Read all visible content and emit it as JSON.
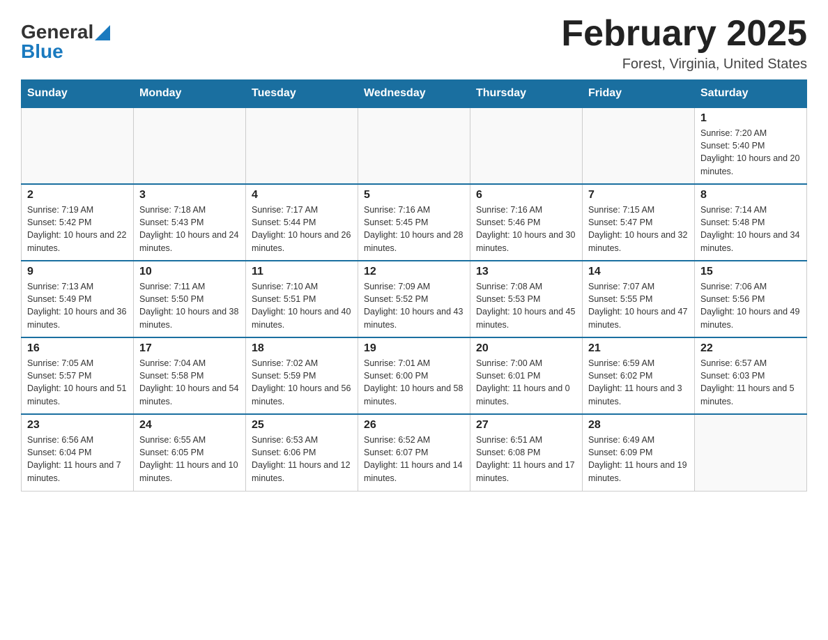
{
  "header": {
    "logo_general": "General",
    "logo_blue": "Blue",
    "month_title": "February 2025",
    "location": "Forest, Virginia, United States"
  },
  "days_of_week": [
    "Sunday",
    "Monday",
    "Tuesday",
    "Wednesday",
    "Thursday",
    "Friday",
    "Saturday"
  ],
  "weeks": [
    [
      {
        "day": "",
        "sunrise": "",
        "sunset": "",
        "daylight": ""
      },
      {
        "day": "",
        "sunrise": "",
        "sunset": "",
        "daylight": ""
      },
      {
        "day": "",
        "sunrise": "",
        "sunset": "",
        "daylight": ""
      },
      {
        "day": "",
        "sunrise": "",
        "sunset": "",
        "daylight": ""
      },
      {
        "day": "",
        "sunrise": "",
        "sunset": "",
        "daylight": ""
      },
      {
        "day": "",
        "sunrise": "",
        "sunset": "",
        "daylight": ""
      },
      {
        "day": "1",
        "sunrise": "Sunrise: 7:20 AM",
        "sunset": "Sunset: 5:40 PM",
        "daylight": "Daylight: 10 hours and 20 minutes."
      }
    ],
    [
      {
        "day": "2",
        "sunrise": "Sunrise: 7:19 AM",
        "sunset": "Sunset: 5:42 PM",
        "daylight": "Daylight: 10 hours and 22 minutes."
      },
      {
        "day": "3",
        "sunrise": "Sunrise: 7:18 AM",
        "sunset": "Sunset: 5:43 PM",
        "daylight": "Daylight: 10 hours and 24 minutes."
      },
      {
        "day": "4",
        "sunrise": "Sunrise: 7:17 AM",
        "sunset": "Sunset: 5:44 PM",
        "daylight": "Daylight: 10 hours and 26 minutes."
      },
      {
        "day": "5",
        "sunrise": "Sunrise: 7:16 AM",
        "sunset": "Sunset: 5:45 PM",
        "daylight": "Daylight: 10 hours and 28 minutes."
      },
      {
        "day": "6",
        "sunrise": "Sunrise: 7:16 AM",
        "sunset": "Sunset: 5:46 PM",
        "daylight": "Daylight: 10 hours and 30 minutes."
      },
      {
        "day": "7",
        "sunrise": "Sunrise: 7:15 AM",
        "sunset": "Sunset: 5:47 PM",
        "daylight": "Daylight: 10 hours and 32 minutes."
      },
      {
        "day": "8",
        "sunrise": "Sunrise: 7:14 AM",
        "sunset": "Sunset: 5:48 PM",
        "daylight": "Daylight: 10 hours and 34 minutes."
      }
    ],
    [
      {
        "day": "9",
        "sunrise": "Sunrise: 7:13 AM",
        "sunset": "Sunset: 5:49 PM",
        "daylight": "Daylight: 10 hours and 36 minutes."
      },
      {
        "day": "10",
        "sunrise": "Sunrise: 7:11 AM",
        "sunset": "Sunset: 5:50 PM",
        "daylight": "Daylight: 10 hours and 38 minutes."
      },
      {
        "day": "11",
        "sunrise": "Sunrise: 7:10 AM",
        "sunset": "Sunset: 5:51 PM",
        "daylight": "Daylight: 10 hours and 40 minutes."
      },
      {
        "day": "12",
        "sunrise": "Sunrise: 7:09 AM",
        "sunset": "Sunset: 5:52 PM",
        "daylight": "Daylight: 10 hours and 43 minutes."
      },
      {
        "day": "13",
        "sunrise": "Sunrise: 7:08 AM",
        "sunset": "Sunset: 5:53 PM",
        "daylight": "Daylight: 10 hours and 45 minutes."
      },
      {
        "day": "14",
        "sunrise": "Sunrise: 7:07 AM",
        "sunset": "Sunset: 5:55 PM",
        "daylight": "Daylight: 10 hours and 47 minutes."
      },
      {
        "day": "15",
        "sunrise": "Sunrise: 7:06 AM",
        "sunset": "Sunset: 5:56 PM",
        "daylight": "Daylight: 10 hours and 49 minutes."
      }
    ],
    [
      {
        "day": "16",
        "sunrise": "Sunrise: 7:05 AM",
        "sunset": "Sunset: 5:57 PM",
        "daylight": "Daylight: 10 hours and 51 minutes."
      },
      {
        "day": "17",
        "sunrise": "Sunrise: 7:04 AM",
        "sunset": "Sunset: 5:58 PM",
        "daylight": "Daylight: 10 hours and 54 minutes."
      },
      {
        "day": "18",
        "sunrise": "Sunrise: 7:02 AM",
        "sunset": "Sunset: 5:59 PM",
        "daylight": "Daylight: 10 hours and 56 minutes."
      },
      {
        "day": "19",
        "sunrise": "Sunrise: 7:01 AM",
        "sunset": "Sunset: 6:00 PM",
        "daylight": "Daylight: 10 hours and 58 minutes."
      },
      {
        "day": "20",
        "sunrise": "Sunrise: 7:00 AM",
        "sunset": "Sunset: 6:01 PM",
        "daylight": "Daylight: 11 hours and 0 minutes."
      },
      {
        "day": "21",
        "sunrise": "Sunrise: 6:59 AM",
        "sunset": "Sunset: 6:02 PM",
        "daylight": "Daylight: 11 hours and 3 minutes."
      },
      {
        "day": "22",
        "sunrise": "Sunrise: 6:57 AM",
        "sunset": "Sunset: 6:03 PM",
        "daylight": "Daylight: 11 hours and 5 minutes."
      }
    ],
    [
      {
        "day": "23",
        "sunrise": "Sunrise: 6:56 AM",
        "sunset": "Sunset: 6:04 PM",
        "daylight": "Daylight: 11 hours and 7 minutes."
      },
      {
        "day": "24",
        "sunrise": "Sunrise: 6:55 AM",
        "sunset": "Sunset: 6:05 PM",
        "daylight": "Daylight: 11 hours and 10 minutes."
      },
      {
        "day": "25",
        "sunrise": "Sunrise: 6:53 AM",
        "sunset": "Sunset: 6:06 PM",
        "daylight": "Daylight: 11 hours and 12 minutes."
      },
      {
        "day": "26",
        "sunrise": "Sunrise: 6:52 AM",
        "sunset": "Sunset: 6:07 PM",
        "daylight": "Daylight: 11 hours and 14 minutes."
      },
      {
        "day": "27",
        "sunrise": "Sunrise: 6:51 AM",
        "sunset": "Sunset: 6:08 PM",
        "daylight": "Daylight: 11 hours and 17 minutes."
      },
      {
        "day": "28",
        "sunrise": "Sunrise: 6:49 AM",
        "sunset": "Sunset: 6:09 PM",
        "daylight": "Daylight: 11 hours and 19 minutes."
      },
      {
        "day": "",
        "sunrise": "",
        "sunset": "",
        "daylight": ""
      }
    ]
  ]
}
